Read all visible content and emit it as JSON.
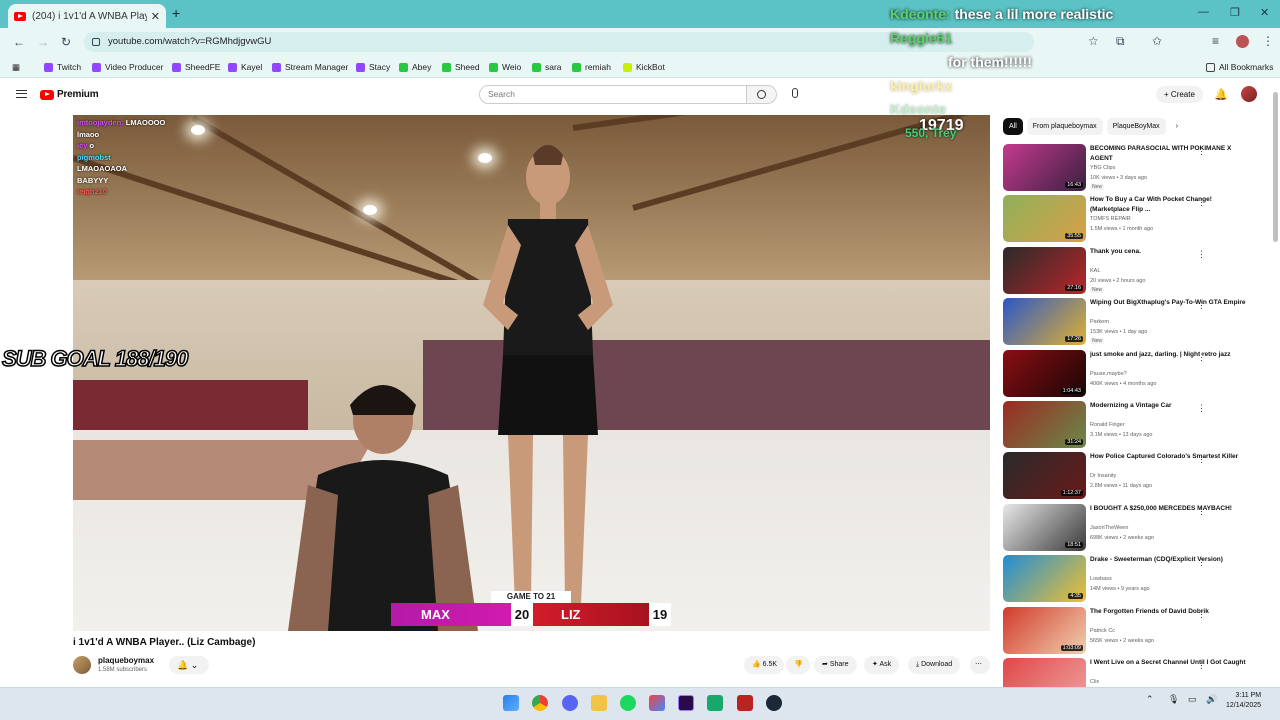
{
  "browser": {
    "tab_title": "(204) i 1v1'd A WNBA Player.",
    "new_tab": "+",
    "url": "youtube.com/watch?v=RGMhdjgvwGU",
    "bookmarks": [
      {
        "label": "Twitch",
        "color": "#9146ff"
      },
      {
        "label": "Video Producer",
        "color": "#9146ff"
      },
      {
        "label": "SheedFE",
        "color": "#9146ff"
      },
      {
        "label": "Kayel",
        "color": "#9146ff"
      },
      {
        "label": "Stream Manager",
        "color": "#9146ff"
      },
      {
        "label": "Stacy",
        "color": "#9146ff"
      },
      {
        "label": "Abey",
        "color": "#28c840"
      },
      {
        "label": "Sheed",
        "color": "#28c840"
      },
      {
        "label": "Weio",
        "color": "#28c840"
      },
      {
        "label": "sara",
        "color": "#28c840"
      },
      {
        "label": "remiah",
        "color": "#28c840"
      },
      {
        "label": "KickBot",
        "color": "#c8f000"
      }
    ],
    "all_bookmarks": "All Bookmarks"
  },
  "youtube": {
    "logo_text": "Premium",
    "search_placeholder": "Search",
    "create_label": "Create",
    "notif_count": "9+"
  },
  "video": {
    "title": "i 1v1'd A WNBA Player.. (Liz Cambage)",
    "channel": "plaqueboymax",
    "subscribers": "1.58M subscribers",
    "likes": "6.5K",
    "share": "Share",
    "ask": "Ask",
    "download": "Download",
    "scoreboard": {
      "header": "GAME TO 21",
      "p1": "MAX",
      "p1_score": "20",
      "p2": "LIZ",
      "p2_score": "19"
    },
    "counter": "19719",
    "counter_sub": "550, Trey",
    "chat": [
      {
        "name": "imtoojayden:",
        "msg": "LMAOOOO"
      },
      {
        "name": "",
        "msg": "lmaoo"
      },
      {
        "name": "icy",
        "msg": "o"
      },
      {
        "name": "pigmobst",
        "msg": ""
      },
      {
        "name": "",
        "msg": "LMAOAOAOA"
      },
      {
        "name": "",
        "msg": "BABYYY"
      },
      {
        "name": "leigh210",
        "msg": ""
      }
    ]
  },
  "overlay": {
    "sub_goal": "SUB GOAL 188/190",
    "chat": [
      {
        "name": "Kdeonte:",
        "msg": "these a lil more realistic",
        "faded": false
      },
      {
        "name": "Reggie61",
        "msg": "",
        "faded": false
      },
      {
        "name": "",
        "msg": "for them!!!!!!",
        "faded": false
      },
      {
        "name": "kinglurkx",
        "msg": "",
        "faded": true
      },
      {
        "name": "Kdeonte",
        "msg": "",
        "faded": true
      }
    ]
  },
  "sidebar": {
    "filters": [
      "All",
      "From plaqueboymax",
      "PlaqueBoyMax"
    ],
    "recommendations": [
      {
        "title": "BECOMING PARASOCIAL WITH POKIMANE X AGENT",
        "channel": "YBG Clips",
        "meta": "10K views • 3 days ago",
        "badge": "New",
        "duration": "16:43",
        "c1": "#c43a8e",
        "c2": "#3a2040"
      },
      {
        "title": "How To Buy a Car With Pocket Change! (Marketplace Flip ...",
        "channel": "TOMFS REPAIR",
        "meta": "1.5M views • 1 month ago",
        "badge": "",
        "duration": "35:55",
        "c1": "#8fb05a",
        "c2": "#d8a048"
      },
      {
        "title": "Thank you cena.",
        "channel": "KAL",
        "meta": "20 views • 2 hours ago",
        "badge": "New",
        "duration": "27:16",
        "c1": "#2a2a2a",
        "c2": "#b8262a"
      },
      {
        "title": "Wiping Out BigXthaplug's Pay-To-Win GTA Empire",
        "channel": "Parkem",
        "meta": "153K views • 1 day ago",
        "badge": "New",
        "duration": "17:26",
        "c1": "#2b57c8",
        "c2": "#e0b030"
      },
      {
        "title": "just smoke and jazz, darling. | Night retro jazz",
        "channel": "Pause.maybe?",
        "meta": "406K views • 4 months ago",
        "badge": "",
        "duration": "1:04:43",
        "c1": "#8a0e12",
        "c2": "#1a0606"
      },
      {
        "title": "Modernizing a Vintage Car",
        "channel": "Ronald Finger",
        "meta": "3.1M views • 13 days ago",
        "badge": "",
        "duration": "31:24",
        "c1": "#9b2a22",
        "c2": "#6a8a4a"
      },
      {
        "title": "How Police Captured Colorado's Smartest Killer",
        "channel": "Dr Insanity",
        "meta": "2.8M views • 11 days ago",
        "badge": "",
        "duration": "1:12:37",
        "c1": "#2a2a2a",
        "c2": "#6a1a1a"
      },
      {
        "title": "I BOUGHT A $250,000 MERCEDES MAYBACH!",
        "channel": "JasonTheWeen",
        "meta": "698K views • 2 weeks ago",
        "badge": "",
        "duration": "18:51",
        "c1": "#e8e8e8",
        "c2": "#3a3a3a"
      },
      {
        "title": "Drake - Sweeterman (CDQ/Explicit Version)",
        "channel": "Lowbass",
        "meta": "14M views • 9 years ago",
        "badge": "",
        "duration": "4:35",
        "c1": "#1e8ed8",
        "c2": "#f0c030"
      },
      {
        "title": "The Forgotten Friends of David Dobrik",
        "channel": "Patrick Cc",
        "meta": "565K views • 2 weeks ago",
        "badge": "",
        "duration": "1:03:09",
        "c1": "#d23a2a",
        "c2": "#f0d0b0"
      },
      {
        "title": "I Went Live on a Secret Channel Until I Got Caught",
        "channel": "Clix",
        "meta": "",
        "badge": "",
        "duration": "",
        "c1": "#e04848",
        "c2": "#f0a0a0"
      }
    ]
  },
  "taskbar": {
    "time": "3:11 PM",
    "date": "12/14/2025"
  }
}
